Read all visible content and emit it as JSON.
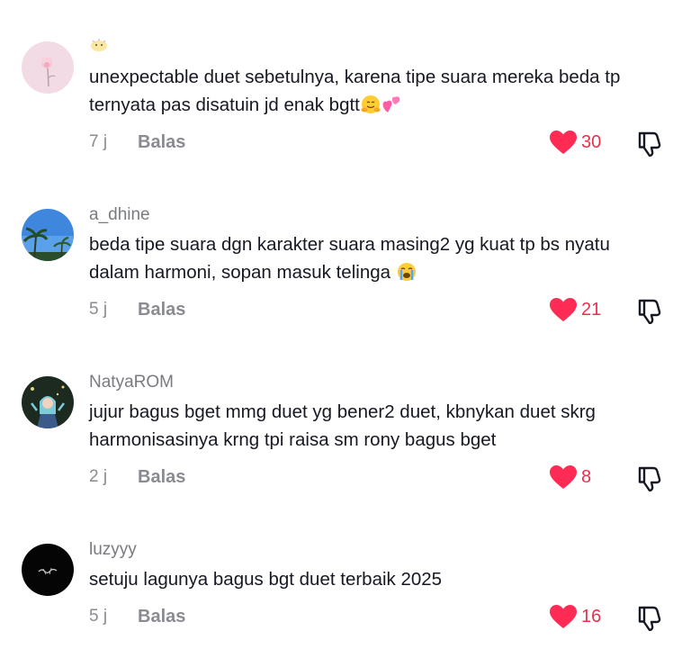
{
  "comments": [
    {
      "username": "",
      "text": "unexpectable duet sebetulnya, karena tipe suara mereka beda tp ternyata pas disatuin jd enak bgtt",
      "emojis": [
        "hugging-face-emoji",
        "two-hearts-emoji"
      ],
      "time": "7 j",
      "reply_label": "Balas",
      "likes": "30",
      "avatar": "pink-flower-avatar"
    },
    {
      "username": "a_dhine",
      "text": "beda tipe suara dgn karakter suara masing2 yg kuat tp bs nyatu dalam harmoni, sopan masuk telinga",
      "emojis": [
        "crying-face-emoji"
      ],
      "time": "5 j",
      "reply_label": "Balas",
      "likes": "21",
      "avatar": "palm-tree-sky-avatar"
    },
    {
      "username": "NatyaROM",
      "text": "jujur bagus bget mmg duet yg bener2 duet, kbnykan duet skrg harmonisasinya krng tpi raisa sm rony bagus bget",
      "emojis": [],
      "time": "2 j",
      "reply_label": "Balas",
      "likes": "8",
      "avatar": "anime-character-avatar"
    },
    {
      "username": "luzyyy",
      "text": "setuju lagunya bagus bgt duet terbaik 2025",
      "emojis": [],
      "time": "5 j",
      "reply_label": "Balas",
      "likes": "16",
      "avatar": "black-signature-avatar"
    }
  ],
  "colors": {
    "like_heart": "#fe2c55",
    "like_count": "#e8304f",
    "muted_text": "#8a8b91",
    "body_text": "#161823"
  },
  "icons": {
    "like": "heart-icon",
    "dislike": "thumbs-down-icon",
    "name_emoji": "small-face-emoji"
  }
}
